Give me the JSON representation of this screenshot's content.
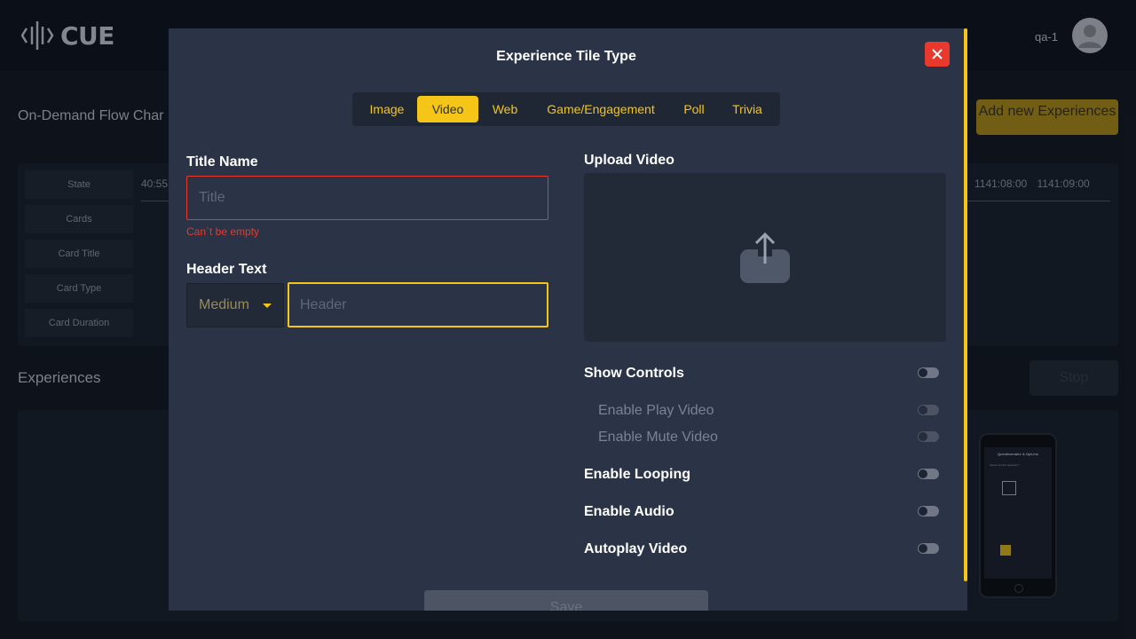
{
  "app": {
    "logo_text": "CUE",
    "user_name": "qa-1"
  },
  "background": {
    "flow_title": "On-Demand Flow Char",
    "add_experience_label": "Add new Experiences",
    "state_rows": [
      "State",
      "Cards",
      "Card Title",
      "Card Type",
      "Card Duration"
    ],
    "timeline_start": "40:55",
    "timeline_end": "1141:08:00 1141:09:00",
    "experiences_title": "Experiences",
    "stop_label": "Stop",
    "phone_preview": {
      "title": "Questionnaire & Opt-ins",
      "subtitle": "Select Correct Question *"
    }
  },
  "modal": {
    "title": "Experience Tile Type",
    "tabs": [
      {
        "label": "Image",
        "active": false
      },
      {
        "label": "Video",
        "active": true
      },
      {
        "label": "Web",
        "active": false
      },
      {
        "label": "Game/Engagement",
        "active": false
      },
      {
        "label": "Poll",
        "active": false
      },
      {
        "label": "Trivia",
        "active": false
      }
    ],
    "title_field": {
      "label": "Title Name",
      "placeholder": "Title",
      "value": "",
      "error": "Can`t be empty"
    },
    "header_field": {
      "label": "Header Text",
      "size_option": "Medium",
      "placeholder": "Header",
      "value": ""
    },
    "upload": {
      "label": "Upload Video",
      "icon": "upload-icon"
    },
    "toggles": [
      {
        "label": "Show Controls",
        "on": false,
        "enabled": true
      },
      {
        "label": "Enable Play Video",
        "on": false,
        "enabled": false
      },
      {
        "label": "Enable Mute Video",
        "on": false,
        "enabled": false
      },
      {
        "label": "Enable Looping",
        "on": false,
        "enabled": true
      },
      {
        "label": "Enable Audio",
        "on": false,
        "enabled": true
      },
      {
        "label": "Autoplay Video",
        "on": false,
        "enabled": true
      }
    ],
    "save_label": "Save"
  },
  "colors": {
    "accent": "#f5c518",
    "error": "#e8392c",
    "modal_bg": "#2b3446"
  }
}
